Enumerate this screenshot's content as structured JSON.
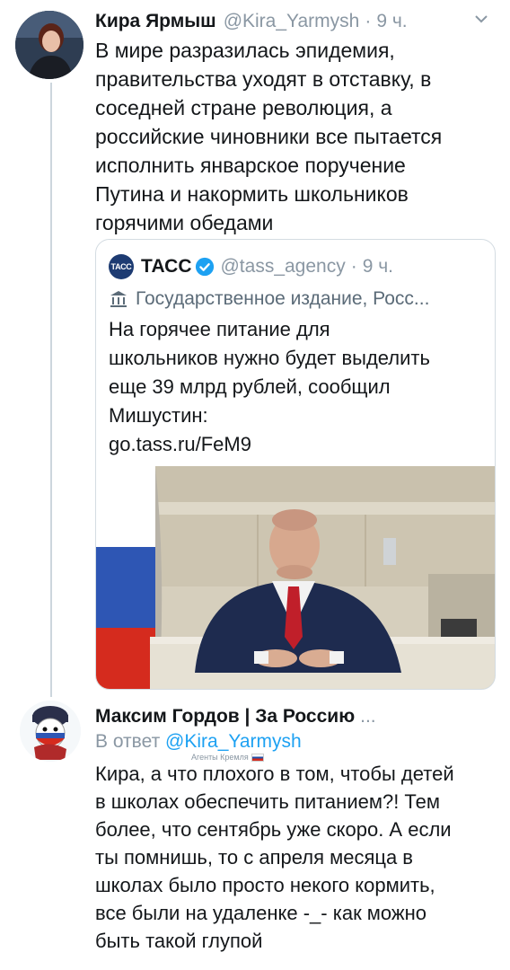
{
  "tweet1": {
    "author_name": "Кира Ярмыш",
    "handle": "@Kira_Yarmysh",
    "separator": "·",
    "time": "9 ч.",
    "text_lines": [
      "В мире разразилась эпидемия,",
      "правительства уходят в отставку, в",
      "соседней стране революция, а",
      "российские чиновники все пытается",
      "исполнить январское поручение",
      "Путина и накормить школьников",
      "горячими обедами"
    ],
    "quote": {
      "logo_text": "ТАСС",
      "author_name": "ТАСС",
      "handle": "@tass_agency",
      "separator": "·",
      "time": "9 ч.",
      "gov_label": "Государственное издание, Росс...",
      "text_lines": [
        "На горячее питание для",
        "школьников нужно будет выделить",
        "еще 39 млрд рублей, сообщил",
        "Мишустин:",
        "go.tass.ru/FeM9"
      ]
    }
  },
  "tweet2": {
    "author_name": "Максим Гордов | За Россию",
    "ellipsis": "...",
    "reply_prefix": "В ответ",
    "reply_handle": "@Kira_Yarmysh",
    "badge_text": "Агенты Кремля",
    "text_lines": [
      "Кира, а что плохого в том, чтобы детей",
      "в школах обеспечить питанием?! Тем",
      "более, что сентябрь уже скоро. А если",
      "ты помнишь, то с апреля месяца в",
      "школах было просто некого кормить,",
      "все были на удаленке -_- как можно",
      "быть такой глупой"
    ]
  },
  "colors": {
    "link": "#1da1f2",
    "muted": "#8a97a3",
    "verified": "#1da1f2",
    "tass_brand": "#1d3b72"
  },
  "icons": [
    "caret-down-icon",
    "verified-badge-icon",
    "government-building-icon"
  ]
}
